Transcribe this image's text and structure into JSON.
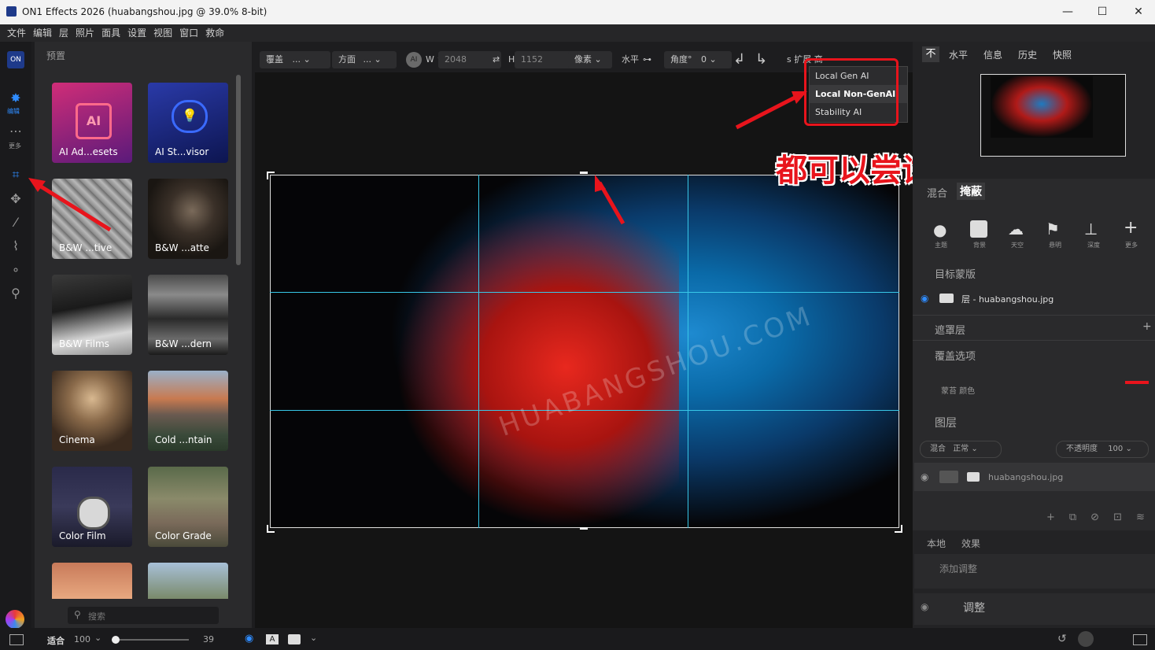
{
  "window": {
    "title": "ON1 Effects 2026 (huabangshou.jpg @ 39.0% 8-bit)",
    "minimize": "—",
    "maximize": "☐",
    "close": "✕"
  },
  "menu": [
    "文件",
    "编辑",
    "层",
    "照片",
    "面具",
    "设置",
    "视图",
    "窗口",
    "救命"
  ],
  "tools": {
    "edit_label": "编辑",
    "more_label": "更多"
  },
  "presets": {
    "header": "预置",
    "items": [
      {
        "label": "AI Ad...esets"
      },
      {
        "label": "AI St...visor"
      },
      {
        "label": "B&W ...tive"
      },
      {
        "label": "B&W ...atte"
      },
      {
        "label": "B&W Films"
      },
      {
        "label": "B&W ...dern"
      },
      {
        "label": "Cinema"
      },
      {
        "label": "Cold ...ntain"
      },
      {
        "label": "Color Film"
      },
      {
        "label": "Color Grade"
      }
    ],
    "search_placeholder": "搜索"
  },
  "toolbar": {
    "fill": "覆盖",
    "fill_val": "...",
    "aspect": "方面",
    "aspect_val": "...",
    "w_label": "W ^",
    "w_val": "2048",
    "h_label": "H",
    "h_val": "1152",
    "unit": "像素",
    "level": "水平",
    "angle": "角度°",
    "angle_val": "0",
    "expand": "s 扩展 高"
  },
  "dropdown": {
    "items": [
      "Local Gen AI",
      "Local Non-GenAI",
      "Stability AI"
    ]
  },
  "annotation": {
    "text": "都可以尝试"
  },
  "watermark": {
    "text": "HUABANGSHOU.COM"
  },
  "right_panel": {
    "tabs": [
      "不",
      "水平",
      "信息",
      "历史",
      "快照"
    ],
    "mask_tabs": [
      "混合",
      "掩蔽"
    ],
    "mask_icons": [
      {
        "label": "主题"
      },
      {
        "label": "背景"
      },
      {
        "label": "天空"
      },
      {
        "label": "悬明"
      },
      {
        "label": "深度"
      },
      {
        "label": "更多"
      }
    ],
    "target_mask": "目标蒙版",
    "layer_name": "层 - huabangshou.jpg",
    "mask_layer": "遮罩层",
    "overlay_options": "覆盖选项",
    "overlay_row": "蒙苔   颜色",
    "layers_title": "图层",
    "blend_label": "混合",
    "blend_val": "正常",
    "opacity_label": "不透明度",
    "opacity_val": "100",
    "layer_file": "huabangshou.jpg",
    "local_tabs": [
      "本地",
      "效果"
    ],
    "add_adjust": "添加调整",
    "adjust": "调整"
  },
  "bottom": {
    "fit": "适合",
    "zoom": "100",
    "slider_val": "39"
  },
  "colors": {
    "accent": "#2f8cff",
    "annotation": "#e8141c",
    "guide": "#38c8e8"
  }
}
